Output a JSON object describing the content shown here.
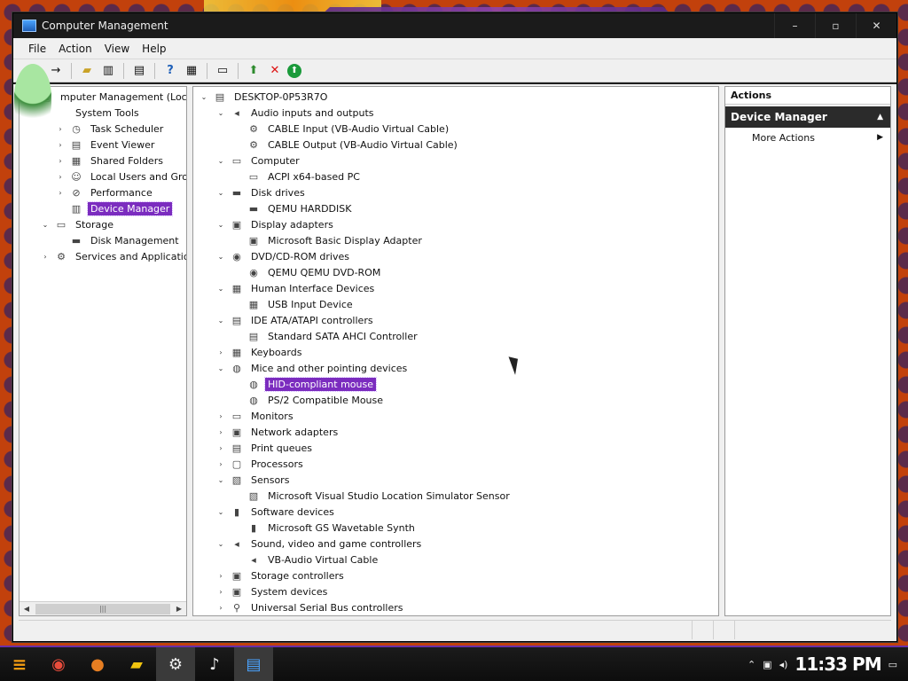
{
  "window": {
    "title": "Computer Management",
    "controls": {
      "minimize": "–",
      "maximize": "▫",
      "close": "✕"
    }
  },
  "menu": [
    "File",
    "Action",
    "View",
    "Help"
  ],
  "left_tree": [
    {
      "label": "mputer Management (Local)",
      "level": 0,
      "expander": "",
      "icon": "computer-management-icon"
    },
    {
      "label": "System Tools",
      "level": 1,
      "expander": "",
      "icon": ""
    },
    {
      "label": "Task Scheduler",
      "level": 2,
      "expander": "›",
      "icon": "clock-icon"
    },
    {
      "label": "Event Viewer",
      "level": 2,
      "expander": "›",
      "icon": "event-viewer-icon"
    },
    {
      "label": "Shared Folders",
      "level": 2,
      "expander": "›",
      "icon": "shared-folder-icon"
    },
    {
      "label": "Local Users and Groups",
      "level": 2,
      "expander": "›",
      "icon": "users-icon"
    },
    {
      "label": "Performance",
      "level": 2,
      "expander": "›",
      "icon": "performance-icon"
    },
    {
      "label": "Device Manager",
      "level": 2,
      "expander": "",
      "icon": "device-manager-icon",
      "selected": true
    },
    {
      "label": "Storage",
      "level": 1,
      "expander": "⌄",
      "icon": "storage-icon"
    },
    {
      "label": "Disk Management",
      "level": 2,
      "expander": "",
      "icon": "disk-icon"
    },
    {
      "label": "Services and Applications",
      "level": 1,
      "expander": "›",
      "icon": "services-icon"
    }
  ],
  "device_tree": [
    {
      "label": "DESKTOP-0P53R7O",
      "level": 0,
      "expander": "⌄",
      "icon": "computer-icon"
    },
    {
      "label": "Audio inputs and outputs",
      "level": 1,
      "expander": "⌄",
      "icon": "speaker-icon"
    },
    {
      "label": "CABLE Input (VB-Audio Virtual Cable)",
      "level": 2,
      "expander": "",
      "icon": "audio-device-icon"
    },
    {
      "label": "CABLE Output (VB-Audio Virtual Cable)",
      "level": 2,
      "expander": "",
      "icon": "audio-device-icon"
    },
    {
      "label": "Computer",
      "level": 1,
      "expander": "⌄",
      "icon": "monitor-icon"
    },
    {
      "label": "ACPI x64-based PC",
      "level": 2,
      "expander": "",
      "icon": "monitor-icon"
    },
    {
      "label": "Disk drives",
      "level": 1,
      "expander": "⌄",
      "icon": "disk-drive-icon"
    },
    {
      "label": "QEMU HARDDISK",
      "level": 2,
      "expander": "",
      "icon": "disk-drive-icon"
    },
    {
      "label": "Display adapters",
      "level": 1,
      "expander": "⌄",
      "icon": "display-adapter-icon"
    },
    {
      "label": "Microsoft Basic Display Adapter",
      "level": 2,
      "expander": "",
      "icon": "display-adapter-icon"
    },
    {
      "label": "DVD/CD-ROM drives",
      "level": 1,
      "expander": "⌄",
      "icon": "dvd-icon"
    },
    {
      "label": "QEMU QEMU DVD-ROM",
      "level": 2,
      "expander": "",
      "icon": "dvd-icon"
    },
    {
      "label": "Human Interface Devices",
      "level": 1,
      "expander": "⌄",
      "icon": "hid-icon"
    },
    {
      "label": "USB Input Device",
      "level": 2,
      "expander": "",
      "icon": "hid-icon"
    },
    {
      "label": "IDE ATA/ATAPI controllers",
      "level": 1,
      "expander": "⌄",
      "icon": "controller-icon"
    },
    {
      "label": "Standard SATA AHCI Controller",
      "level": 2,
      "expander": "",
      "icon": "controller-icon"
    },
    {
      "label": "Keyboards",
      "level": 1,
      "expander": "›",
      "icon": "keyboard-icon"
    },
    {
      "label": "Mice and other pointing devices",
      "level": 1,
      "expander": "⌄",
      "icon": "mouse-icon"
    },
    {
      "label": "HID-compliant mouse",
      "level": 2,
      "expander": "",
      "icon": "mouse-icon",
      "selected": true
    },
    {
      "label": "PS/2 Compatible Mouse",
      "level": 2,
      "expander": "",
      "icon": "mouse-icon"
    },
    {
      "label": "Monitors",
      "level": 1,
      "expander": "›",
      "icon": "monitor-icon"
    },
    {
      "label": "Network adapters",
      "level": 1,
      "expander": "›",
      "icon": "network-icon"
    },
    {
      "label": "Print queues",
      "level": 1,
      "expander": "›",
      "icon": "printer-icon"
    },
    {
      "label": "Processors",
      "level": 1,
      "expander": "›",
      "icon": "processor-icon"
    },
    {
      "label": "Sensors",
      "level": 1,
      "expander": "⌄",
      "icon": "sensor-icon"
    },
    {
      "label": "Microsoft Visual Studio Location Simulator Sensor",
      "level": 2,
      "expander": "",
      "icon": "sensor-icon"
    },
    {
      "label": "Software devices",
      "level": 1,
      "expander": "⌄",
      "icon": "software-device-icon"
    },
    {
      "label": "Microsoft GS Wavetable Synth",
      "level": 2,
      "expander": "",
      "icon": "software-device-icon"
    },
    {
      "label": "Sound, video and game controllers",
      "level": 1,
      "expander": "⌄",
      "icon": "speaker-icon"
    },
    {
      "label": "VB-Audio Virtual Cable",
      "level": 2,
      "expander": "",
      "icon": "speaker-icon"
    },
    {
      "label": "Storage controllers",
      "level": 1,
      "expander": "›",
      "icon": "storage-controller-icon"
    },
    {
      "label": "System devices",
      "level": 1,
      "expander": "›",
      "icon": "system-device-icon"
    },
    {
      "label": "Universal Serial Bus controllers",
      "level": 1,
      "expander": "›",
      "icon": "usb-icon"
    }
  ],
  "actions": {
    "header": "Actions",
    "section": "Device Manager",
    "items": [
      "More Actions"
    ]
  },
  "taskbar": {
    "clock": "11:33 PM"
  },
  "icons": {
    "computer-management-icon": "▣",
    "clock-icon": "◷",
    "event-viewer-icon": "▤",
    "shared-folder-icon": "▦",
    "users-icon": "☺",
    "performance-icon": "⊘",
    "device-manager-icon": "▥",
    "storage-icon": "▭",
    "disk-icon": "▬",
    "services-icon": "⚙",
    "computer-icon": "▤",
    "speaker-icon": "◂",
    "audio-device-icon": "⚙",
    "monitor-icon": "▭",
    "disk-drive-icon": "▬",
    "display-adapter-icon": "▣",
    "dvd-icon": "◉",
    "hid-icon": "▦",
    "controller-icon": "▤",
    "keyboard-icon": "▦",
    "mouse-icon": "◍",
    "network-icon": "▣",
    "printer-icon": "▤",
    "processor-icon": "▢",
    "sensor-icon": "▧",
    "software-device-icon": "▮",
    "storage-controller-icon": "▣",
    "system-device-icon": "▣",
    "usb-icon": "⚲"
  },
  "colors": {
    "selection": "#7b2cbf",
    "accent": "#6a2fa8",
    "taskbar": "#0d0d0d"
  }
}
